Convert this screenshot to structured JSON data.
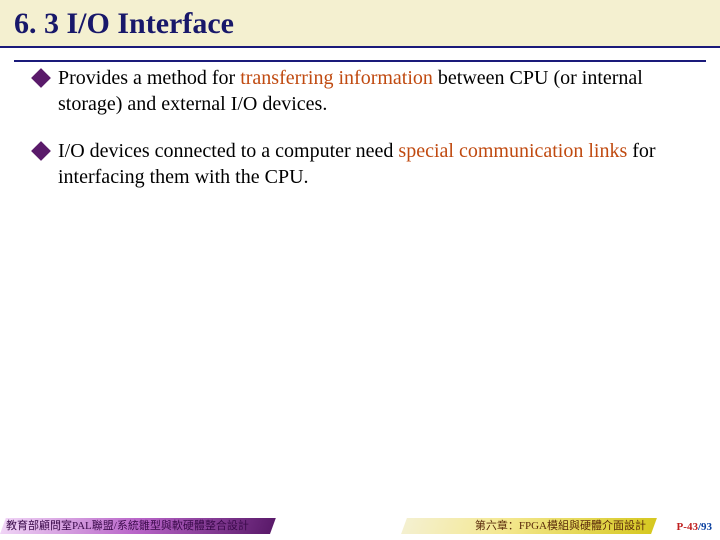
{
  "title": "6. 3 I/O Interface",
  "bullets": [
    {
      "pre": "Provides a method for ",
      "emph": "transferring information",
      "post": " between CPU (or internal storage) and external I/O devices."
    },
    {
      "pre": "I/O devices connected to a computer need ",
      "emph": "special communication links",
      "post": " for interfacing them with the CPU."
    }
  ],
  "footer": {
    "left": "教育部顧問室PAL聯盟/系統雛型與軟硬體整合設計",
    "center": "第六章：FPGA模組與硬體介面設計",
    "page_prefix": "P-",
    "page_current": "43",
    "page_sep": "/",
    "page_total": "93"
  }
}
